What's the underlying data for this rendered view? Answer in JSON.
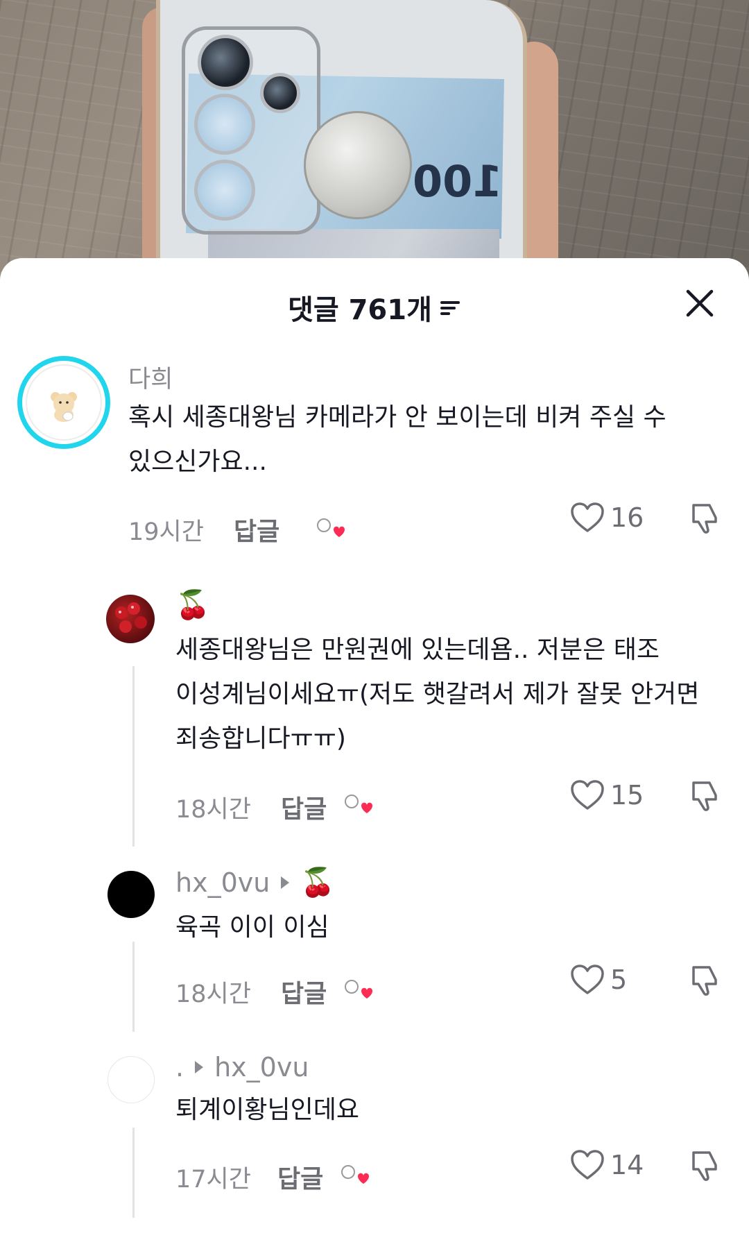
{
  "sheet": {
    "title": "댓글 761개",
    "sort_icon": "sort-lines-icon",
    "close_icon": "close-icon"
  },
  "comments": [
    {
      "username": "다희",
      "text_line1": "혹시 세종대왕님 카메라가 안 보이는데 비켜 주실 수",
      "text_line2": "있으신가요...",
      "time": "19시간",
      "reply_label": "답글",
      "likes": "16",
      "creator_liked": true
    },
    {
      "username": "🍒",
      "text_line1": "세종대왕님은 만원권에 있는데욤.. 저분은 태조",
      "text_line2": "이성계님이세요ㅠ(저도 햇갈려서 제가 잘못 안거면",
      "text_line3": "죄송합니다ㅠㅠ)",
      "time": "18시간",
      "reply_label": "답글",
      "likes": "15",
      "creator_liked": true
    },
    {
      "username": "hx_0vu",
      "reply_to": "🍒",
      "text_line1": "육곡 이이 이심",
      "time": "18시간",
      "reply_label": "답글",
      "likes": "5",
      "creator_liked": true
    },
    {
      "username": ".",
      "reply_to": "hx_0vu",
      "text_line1": "퇴계이황님인데요",
      "time": "17시간",
      "reply_label": "답글",
      "likes": "14",
      "creator_liked": true
    }
  ],
  "colors": {
    "text_primary": "#161823",
    "text_secondary": "#8a8b91",
    "heart_red": "#fe2c55",
    "avatar_ring": "#20d5ec"
  }
}
